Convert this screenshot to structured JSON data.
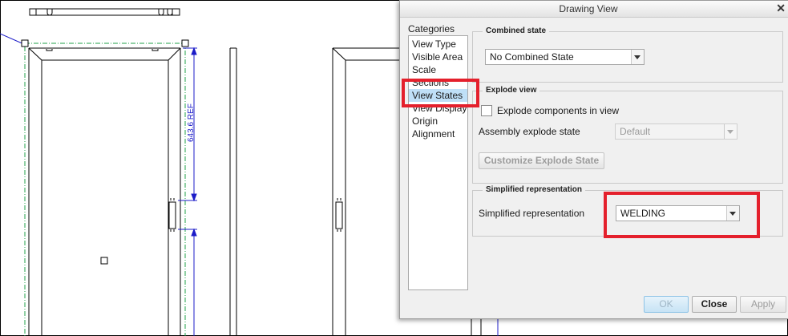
{
  "drawing": {
    "dimension_label": "643.6 REF"
  },
  "dialog": {
    "title": "Drawing View",
    "close_icon": "close-icon",
    "categories_label": "Categories",
    "categories": [
      {
        "label": "View Type"
      },
      {
        "label": "Visible Area"
      },
      {
        "label": "Scale"
      },
      {
        "label": "Sections"
      },
      {
        "label": "View States",
        "selected": true
      },
      {
        "label": "View Display"
      },
      {
        "label": "Origin"
      },
      {
        "label": "Alignment"
      }
    ],
    "combined_state": {
      "group_label": "Combined state",
      "value": "No Combined State"
    },
    "explode_view": {
      "group_label": "Explode view",
      "checkbox_label": "Explode components in view",
      "checked": false,
      "assembly_label": "Assembly explode state",
      "assembly_value": "Default",
      "customize_button": "Customize Explode State"
    },
    "simplified": {
      "group_label": "Simplified representation",
      "field_label": "Simplified representation",
      "value": "WELDING"
    },
    "buttons": {
      "ok": "OK",
      "close": "Close",
      "apply": "Apply"
    },
    "colors": {
      "highlight": "#e4202c",
      "selection": "#bfe0f7"
    }
  }
}
